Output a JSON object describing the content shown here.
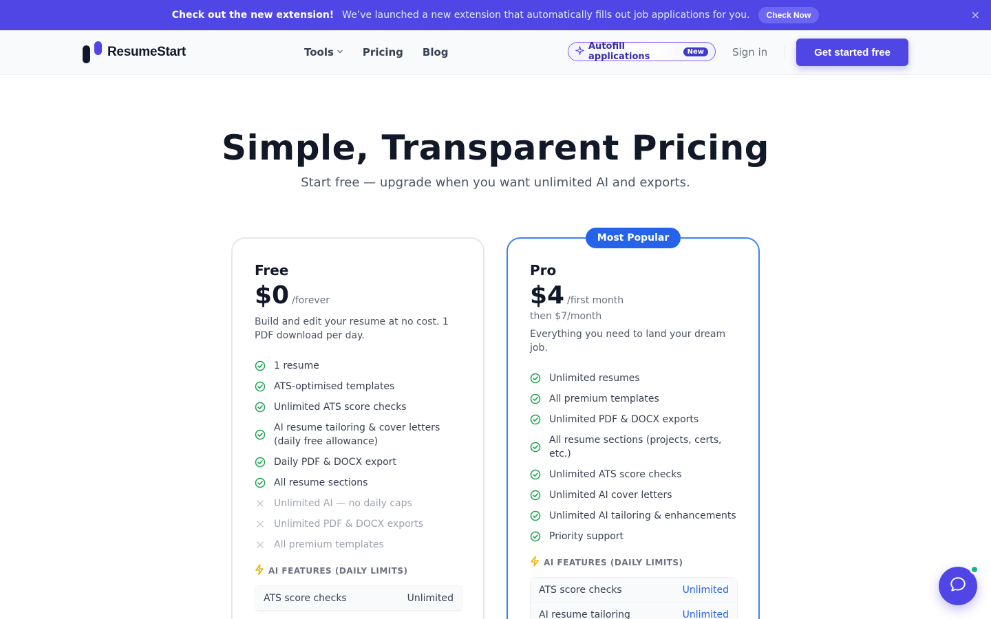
{
  "announcement": {
    "headline": "Check out the new extension!",
    "message": "We’ve launched a new extension that automatically fills out job applications for you.",
    "button": "Check Now",
    "close_icon": "×"
  },
  "header": {
    "brand": "ResumeStart",
    "nav": [
      {
        "label": "Tools"
      },
      {
        "label": "Pricing"
      },
      {
        "label": "Blog"
      }
    ],
    "autofill_label": "Autofill applications",
    "autofill_badge": "New",
    "signin": "Sign in",
    "cta": "Get started free"
  },
  "hero": {
    "title": "Simple, Transparent Pricing",
    "subtitle": "Start free — upgrade when you want unlimited AI and exports."
  },
  "plans": {
    "free": {
      "name": "Free",
      "price": "$0",
      "period": "/forever",
      "description": "Build and edit your resume at no cost. 1 PDF download per day.",
      "features": [
        {
          "label": "1 resume",
          "included": true
        },
        {
          "label": "ATS-optimised templates",
          "included": true
        },
        {
          "label": "Unlimited ATS score checks",
          "included": true
        },
        {
          "label": "AI resume tailoring & cover letters (daily free allowance)",
          "included": true
        },
        {
          "label": "Daily PDF & DOCX export",
          "included": true
        },
        {
          "label": "All resume sections",
          "included": true
        },
        {
          "label": "Unlimited AI — no daily caps",
          "included": false
        },
        {
          "label": "Unlimited PDF & DOCX exports",
          "included": false
        },
        {
          "label": "All premium templates",
          "included": false
        }
      ],
      "ai_heading": "AI FEATURES (DAILY LIMITS)",
      "ai_rows": [
        {
          "name": "ATS score checks",
          "value": "Unlimited"
        }
      ]
    },
    "pro": {
      "badge": "Most Popular",
      "name": "Pro",
      "price": "$4",
      "period": "/first month",
      "then": "then $7/month",
      "description": "Everything you need to land your dream job.",
      "features": [
        {
          "label": "Unlimited resumes",
          "included": true
        },
        {
          "label": "All premium templates",
          "included": true
        },
        {
          "label": "Unlimited PDF & DOCX exports",
          "included": true
        },
        {
          "label": "All resume sections (projects, certs, etc.)",
          "included": true
        },
        {
          "label": "Unlimited ATS score checks",
          "included": true
        },
        {
          "label": "Unlimited AI cover letters",
          "included": true
        },
        {
          "label": "Unlimited AI tailoring & enhancements",
          "included": true
        },
        {
          "label": "Priority support",
          "included": true
        }
      ],
      "ai_heading": "AI FEATURES (DAILY LIMITS)",
      "ai_rows": [
        {
          "name": "ATS score checks",
          "value": "Unlimited"
        },
        {
          "name": "AI resume tailoring",
          "value": "Unlimited"
        }
      ]
    }
  },
  "colors": {
    "accent": "#4f46e5",
    "pro_border": "#3b82f6",
    "check": "#16a34a",
    "online": "#10b981"
  }
}
